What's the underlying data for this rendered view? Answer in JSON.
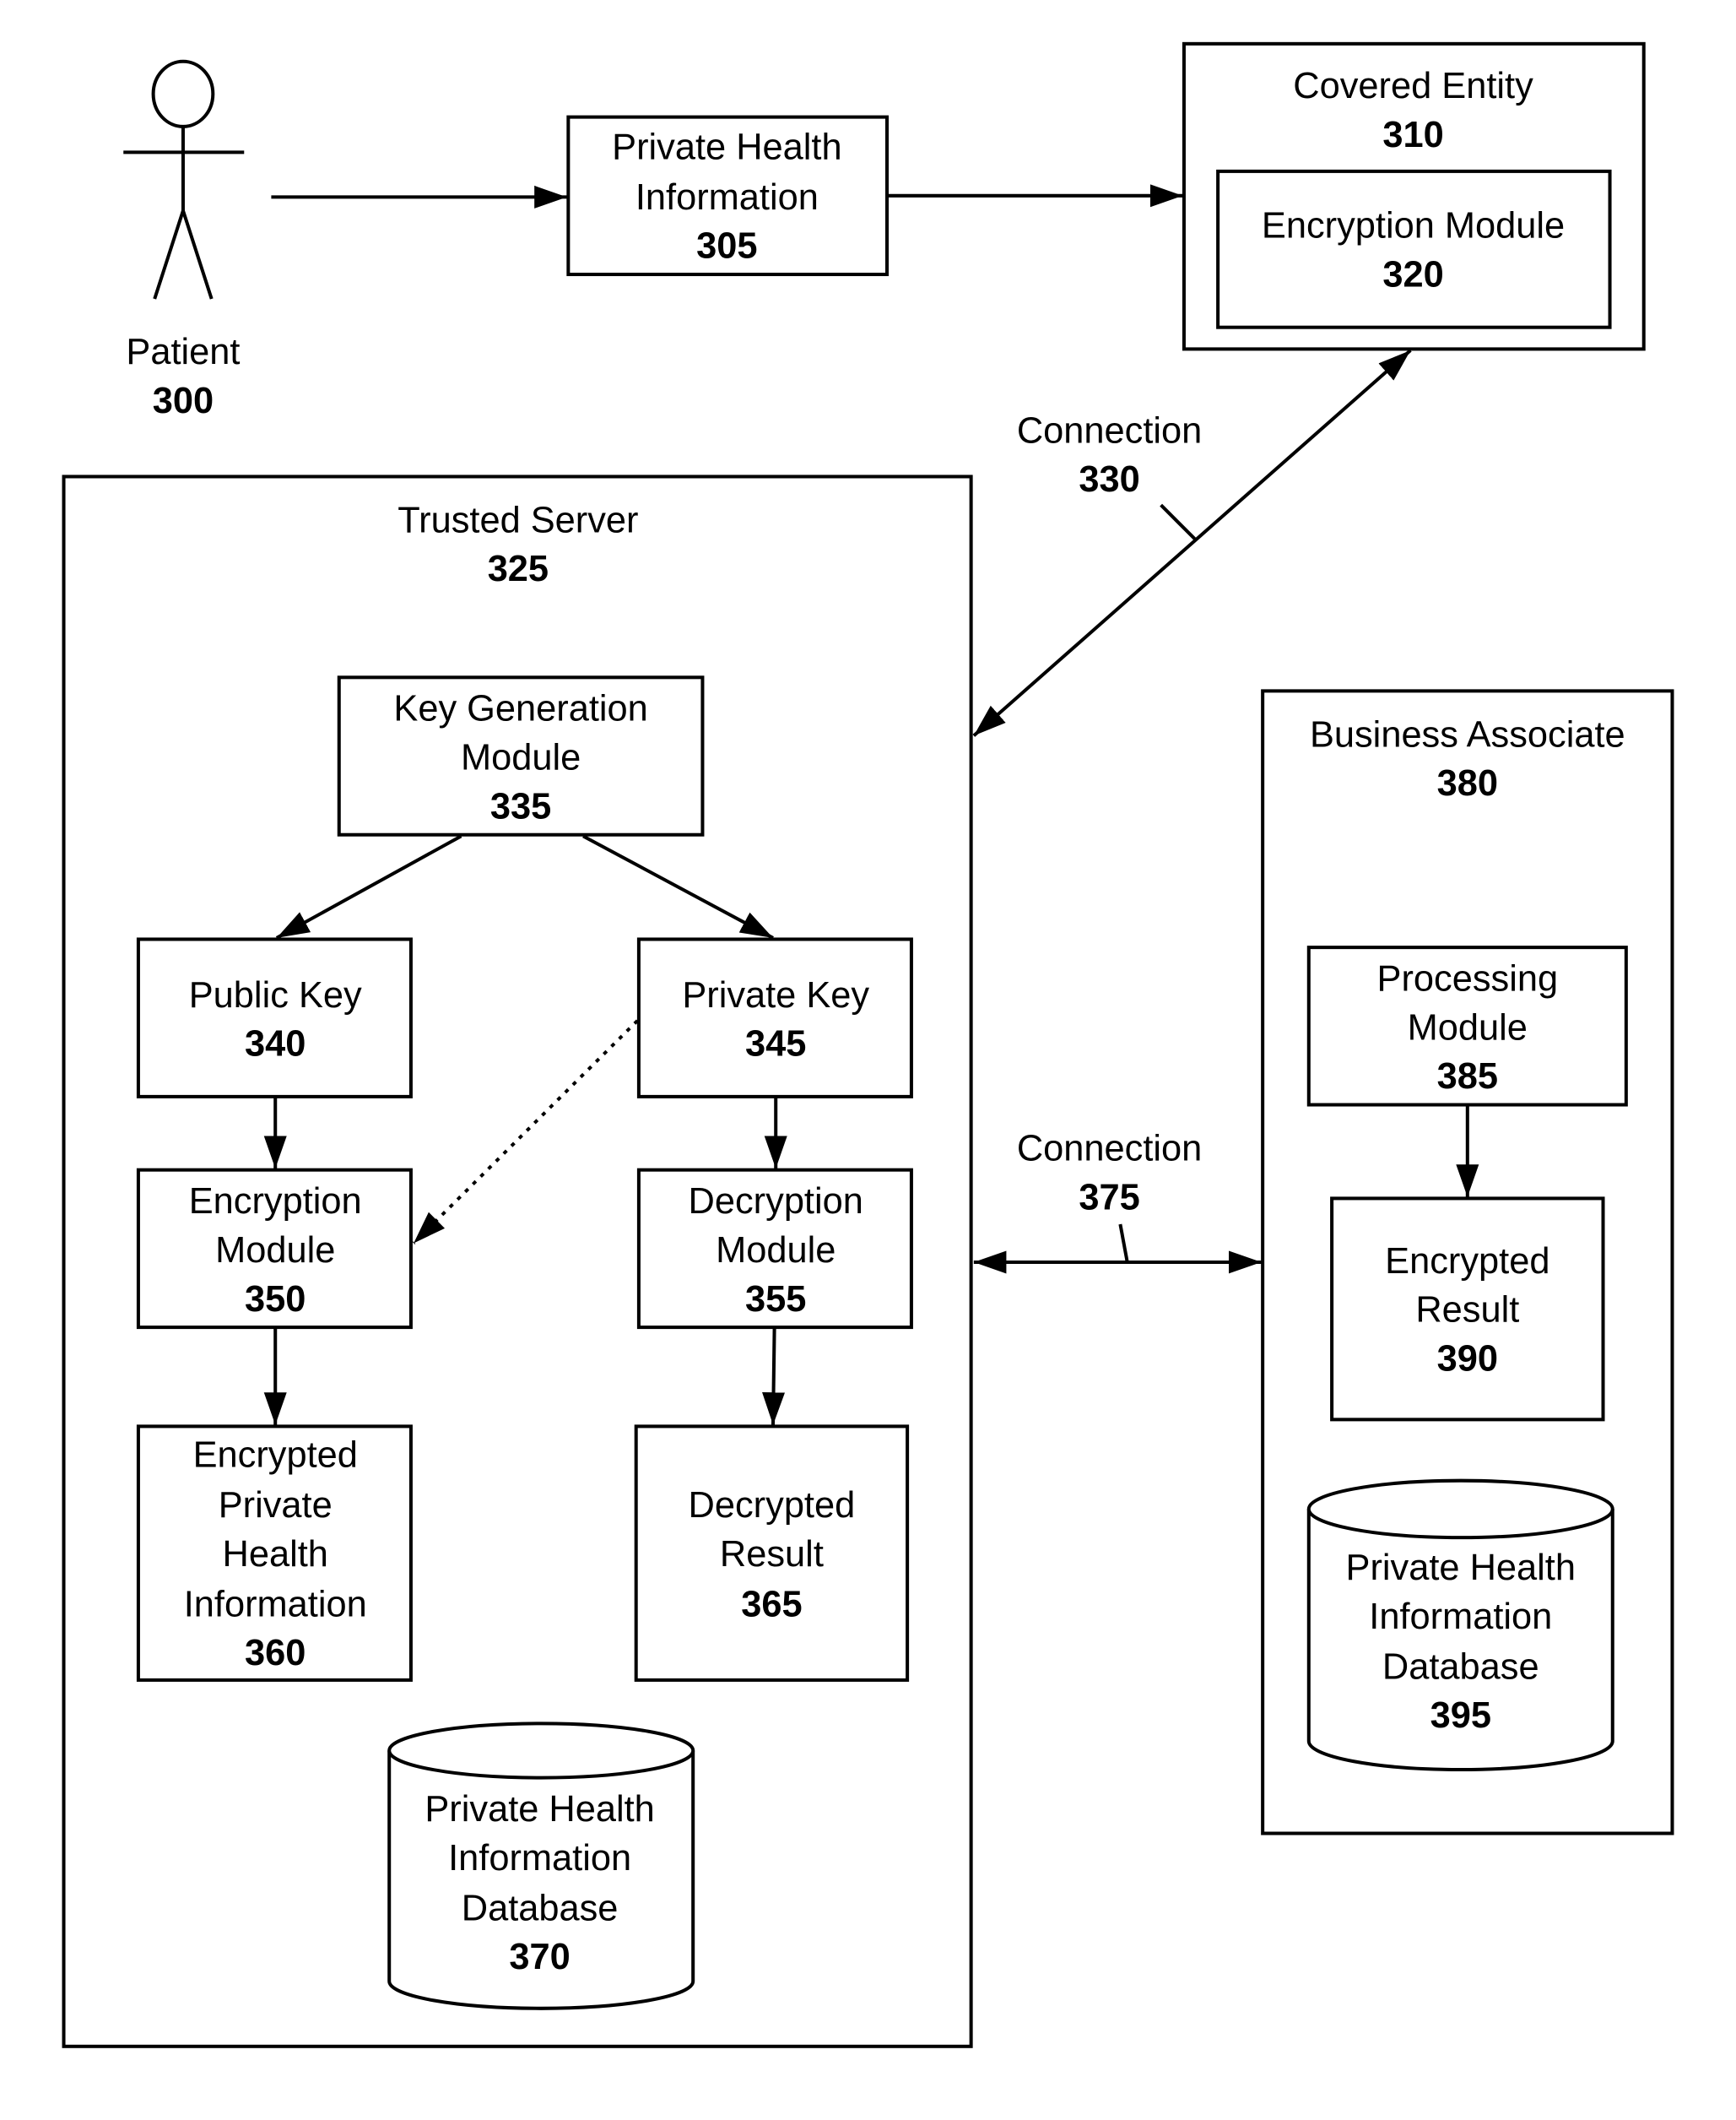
{
  "diagram": {
    "patient": {
      "label": "Patient",
      "ref": "300"
    },
    "phi": {
      "lines": [
        "Private Health",
        "Information"
      ],
      "ref": "305"
    },
    "covered_entity": {
      "label": "Covered Entity",
      "ref": "310"
    },
    "ce_encryption": {
      "label": "Encryption Module",
      "ref": "320"
    },
    "connection_330": {
      "label": "Connection",
      "ref": "330"
    },
    "trusted_server": {
      "label": "Trusted Server",
      "ref": "325"
    },
    "key_gen": {
      "lines": [
        "Key Generation",
        "Module"
      ],
      "ref": "335"
    },
    "public_key": {
      "label": "Public Key",
      "ref": "340"
    },
    "private_key": {
      "label": "Private Key",
      "ref": "345"
    },
    "ts_encryption": {
      "lines": [
        "Encryption",
        "Module"
      ],
      "ref": "350"
    },
    "decryption": {
      "lines": [
        "Decryption",
        "Module"
      ],
      "ref": "355"
    },
    "encrypted_phi": {
      "lines": [
        "Encrypted",
        "Private",
        "Health",
        "Information"
      ],
      "ref": "360"
    },
    "decrypted_result": {
      "lines": [
        "Decrypted",
        "Result"
      ],
      "ref": "365"
    },
    "ts_db": {
      "lines": [
        "Private Health",
        "Information",
        "Database"
      ],
      "ref": "370"
    },
    "connection_375": {
      "label": "Connection",
      "ref": "375"
    },
    "business_associate": {
      "label": "Business Associate",
      "ref": "380"
    },
    "processing": {
      "lines": [
        "Processing",
        "Module"
      ],
      "ref": "385"
    },
    "encrypted_result": {
      "lines": [
        "Encrypted",
        "Result"
      ],
      "ref": "390"
    },
    "ba_db": {
      "lines": [
        "Private Health",
        "Information",
        "Database"
      ],
      "ref": "395"
    }
  }
}
